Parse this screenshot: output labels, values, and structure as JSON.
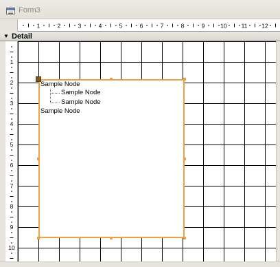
{
  "window": {
    "title": "Form3"
  },
  "ruler": {
    "horizontal_marks": [
      "1",
      "2",
      "3",
      "4",
      "5",
      "6",
      "7",
      "8",
      "9",
      "10",
      "11",
      "12"
    ],
    "vertical_marks": [
      "1",
      "2",
      "3",
      "4",
      "5",
      "6",
      "7",
      "8",
      "9",
      "10"
    ]
  },
  "section": {
    "label": "Detail"
  },
  "treeview": {
    "nodes": [
      {
        "label": "Sample Node",
        "level": 0
      },
      {
        "label": "Sample Node",
        "level": 1
      },
      {
        "label": "Sample Node",
        "level": 1
      },
      {
        "label": "Sample Node",
        "level": 0
      }
    ]
  },
  "colors": {
    "selection_border": "#f0a040",
    "grid_line": "#000000"
  }
}
